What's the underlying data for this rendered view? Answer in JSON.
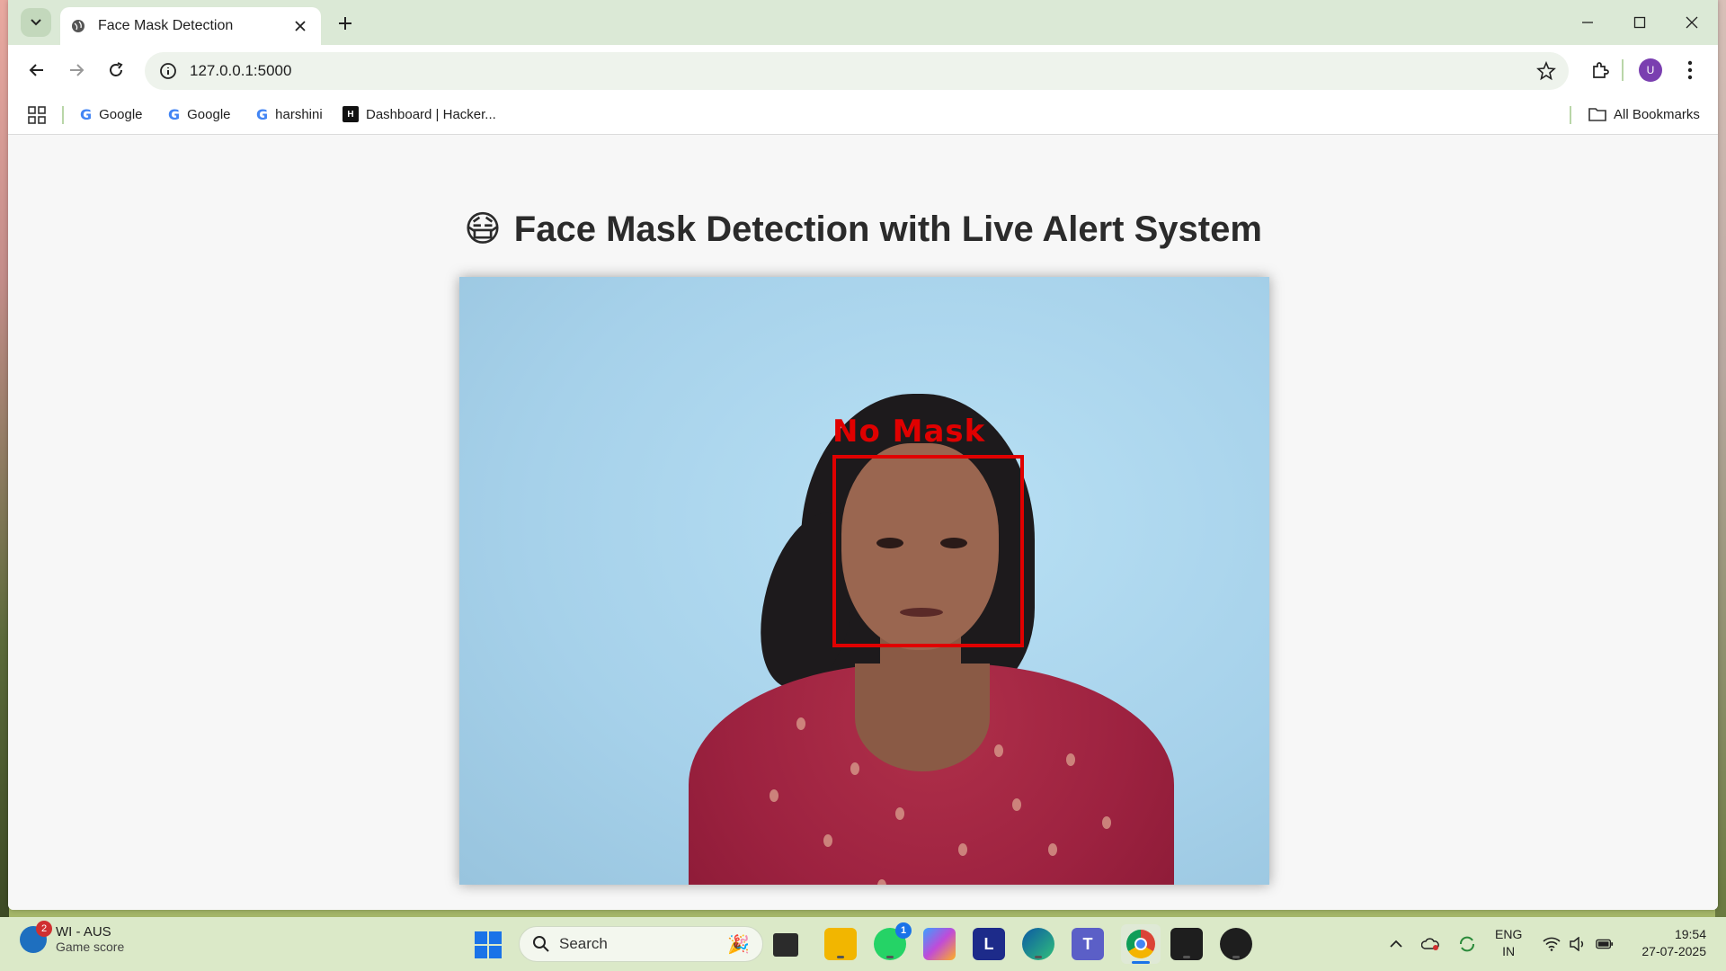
{
  "browser": {
    "tab_title": "Face Mask Detection",
    "url": "127.0.0.1:5000",
    "avatar_letter": "U",
    "bookmarks": [
      {
        "label": "Google",
        "icon": "google-icon"
      },
      {
        "label": "Google",
        "icon": "google-icon"
      },
      {
        "label": "harshini",
        "icon": "google-icon"
      },
      {
        "label": "Dashboard | Hacker...",
        "icon": "hackerrank-icon"
      }
    ],
    "all_bookmarks": "All Bookmarks"
  },
  "page": {
    "emoji": "😷",
    "heading": "Face Mask Detection with Live Alert System",
    "detection_label": "No Mask",
    "detection_color": "#e00000"
  },
  "taskbar": {
    "widget_title": "WI - AUS",
    "widget_subtitle": "Game score",
    "widget_badge": "2",
    "search_placeholder": "Search",
    "whatsapp_badge": "1",
    "lang_top": "ENG",
    "lang_bottom": "IN",
    "time": "19:54",
    "date": "27-07-2025"
  }
}
